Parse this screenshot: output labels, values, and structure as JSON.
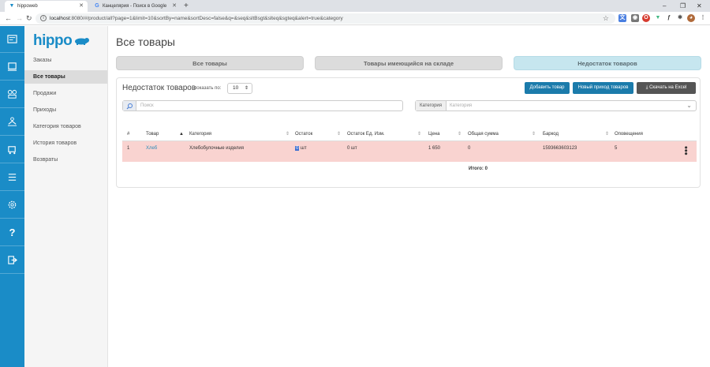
{
  "browser": {
    "tabs": [
      {
        "title": "hippoweb",
        "active": true
      },
      {
        "title": "Канцелярия - Поиск в Google",
        "active": false
      }
    ],
    "url_host": "localhost",
    "url_rest": ":8080/#/product/all?page=1&limit=10&sortBy=name&sortDesc=false&q=&seq&sltBsgt&slteq&sgteq&alert=true&category"
  },
  "app": {
    "logo": "hippo",
    "rail_icons": [
      "orders-icon",
      "sales-icon",
      "products-icon",
      "arrivals-icon",
      "categories-icon",
      "history-icon",
      "settings-icon",
      "help-icon",
      "logout-icon"
    ]
  },
  "menu": {
    "items": [
      {
        "label": "Заказы",
        "active": false
      },
      {
        "label": "Все товары",
        "active": true
      },
      {
        "label": "Продажи",
        "active": false
      },
      {
        "label": "Приходы",
        "active": false
      },
      {
        "label": "Категория товаров",
        "active": false
      },
      {
        "label": "История товаров",
        "active": false
      },
      {
        "label": "Возвраты",
        "active": false
      }
    ]
  },
  "page": {
    "title": "Все товары",
    "segments": [
      {
        "label": "Все товары",
        "active": false
      },
      {
        "label": "Товары имеющийся на складе",
        "active": false
      },
      {
        "label": "Недостаток товаров",
        "active": true
      }
    ]
  },
  "card": {
    "title": "Недостаток товаров",
    "show_label": "показать по:",
    "show_value": "10",
    "add_button": "Добавить товар",
    "new_arrival_button": "Новый приход товаров",
    "excel_button": "Скачать на Excel",
    "search_placeholder": "Поиск",
    "category_label": "Категория",
    "category_placeholder": "Категория"
  },
  "table": {
    "headers": [
      "#",
      "Товар",
      "Категория",
      "Остаток",
      "Остаток Ед. Изм.",
      "Цена",
      "Общая сумма",
      "Баркод",
      "Оповещения"
    ],
    "rows": [
      {
        "num": "1",
        "product": "Хлеб",
        "category": "Хлебобулочные изделия",
        "stock_sel": "0",
        "stock": " шт",
        "stock_unit": "0 шт",
        "price": "1 650",
        "sum": "0",
        "barcode": "1593663603123",
        "alerts": "5"
      }
    ],
    "total": "Итого: 0"
  },
  "colors": {
    "accent": "#1a8cc7",
    "row_alert": "#f9d3d0",
    "active_segment": "#c6e6ef"
  }
}
